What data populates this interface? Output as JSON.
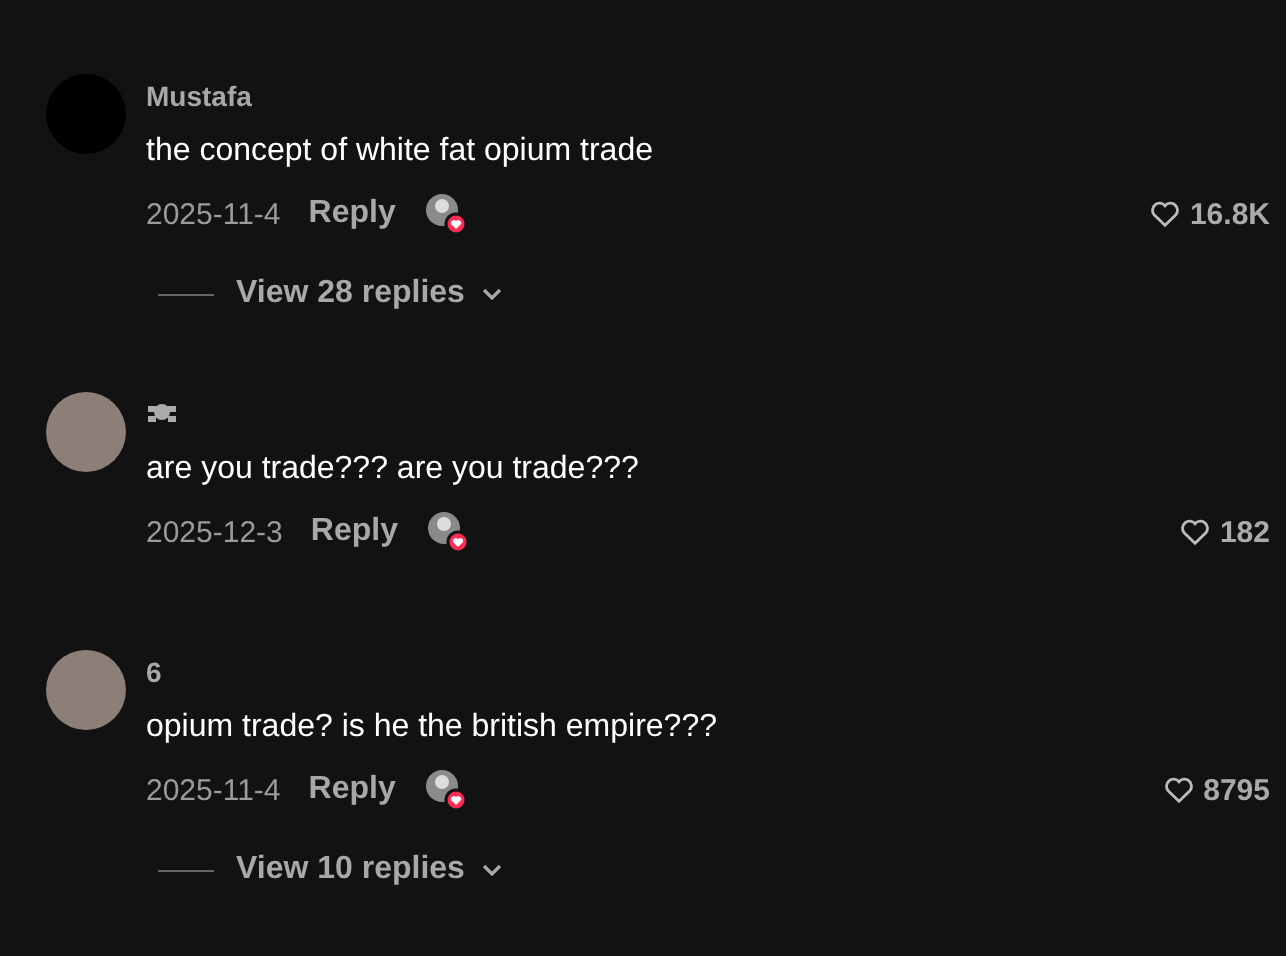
{
  "comments": [
    {
      "author": "Mustafa",
      "avatar_photo": false,
      "text": "the concept of white fat opium trade",
      "date": "2025-11-4",
      "reply": "Reply",
      "creator_liked": true,
      "likes": "16.8K",
      "view_replies": "View 28 replies"
    },
    {
      "avatar_photo": true,
      "text": "are you trade??? are you trade???",
      "date": "2025-12-3",
      "reply": "Reply",
      "creator_liked": true,
      "likes": "182"
    },
    {
      "author": "6",
      "avatar_photo": true,
      "text": "opium trade? is he the british empire???",
      "date": "2025-11-4",
      "reply": "Reply",
      "creator_liked": true,
      "likes": "8795",
      "view_replies": "View 10 replies"
    }
  ]
}
